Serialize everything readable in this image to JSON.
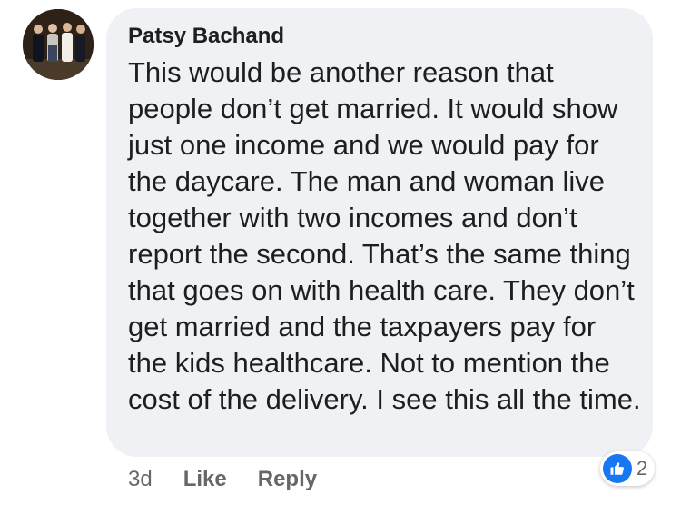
{
  "comment": {
    "author": "Patsy Bachand",
    "text": "This would be another reason that people don’t get married. It would show just one income and we would pay for the daycare. The man and woman live together with two incomes and don’t report the second. That’s the same thing that goes on with health care. They don’t get married and the taxpayers pay for the kids healthcare. Not to mention the cost of the delivery. I see this all the time.",
    "time": "3d",
    "like_label": "Like",
    "reply_label": "Reply",
    "reaction_count": "2",
    "reaction_icon": "thumbs-up-icon"
  },
  "colors": {
    "bubble_background": "#f0f1f4",
    "text": "#1c1e21",
    "meta_text": "#65676b",
    "like_blue": "#1877f2"
  }
}
